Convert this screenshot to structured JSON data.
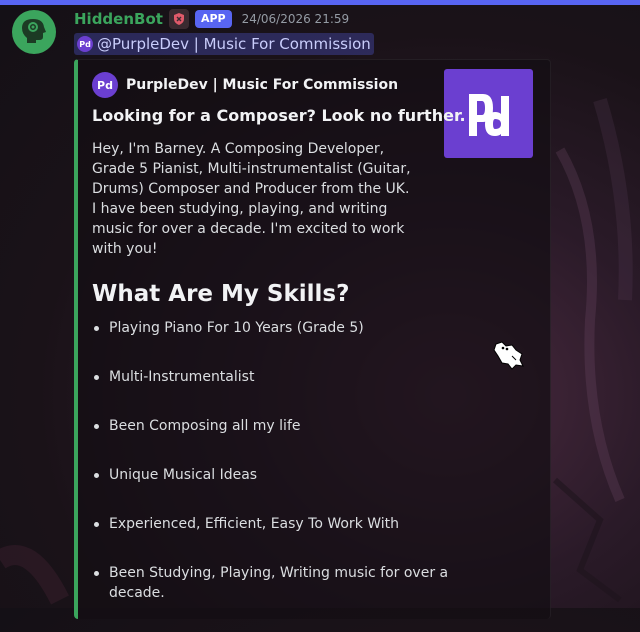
{
  "message": {
    "username": "HiddenBot",
    "app_badge": "APP",
    "timestamp": "24/06/2026 21:59",
    "mention": "@PurpleDev | Music For Commission",
    "mention_icon": "Pd"
  },
  "embed": {
    "accent_color": "#3ba55d",
    "author": {
      "name": "PurpleDev | Music For Commission",
      "icon_text": "Pd"
    },
    "thumbnail_text": "Pd",
    "title": "Looking for a Composer? Look no further.",
    "description": "Hey, I'm Barney. A Composing Developer, Grade 5 Pianist, Multi-instrumentalist (Guitar, Drums) Composer and Producer from the UK. I have been studying, playing, and writing music for over a decade. I'm excited to work with you!",
    "heading": "What Are My Skills?",
    "skills": [
      "Playing Piano For 10 Years (Grade 5)",
      "Multi-Instrumentalist",
      "Been Composing all my life",
      "Unique Musical Ideas",
      "Experienced, Efficient, Easy To Work With",
      "Been Studying, Playing, Writing music for over a decade."
    ]
  },
  "colors": {
    "username": "#3ba55d",
    "app_badge": "#5865f2",
    "brand_purple": "#6b3fd0"
  },
  "icons": {
    "avatar": "robot-head-gear-icon",
    "badge": "shield-icon",
    "cursor": "cat-cursor-icon"
  }
}
